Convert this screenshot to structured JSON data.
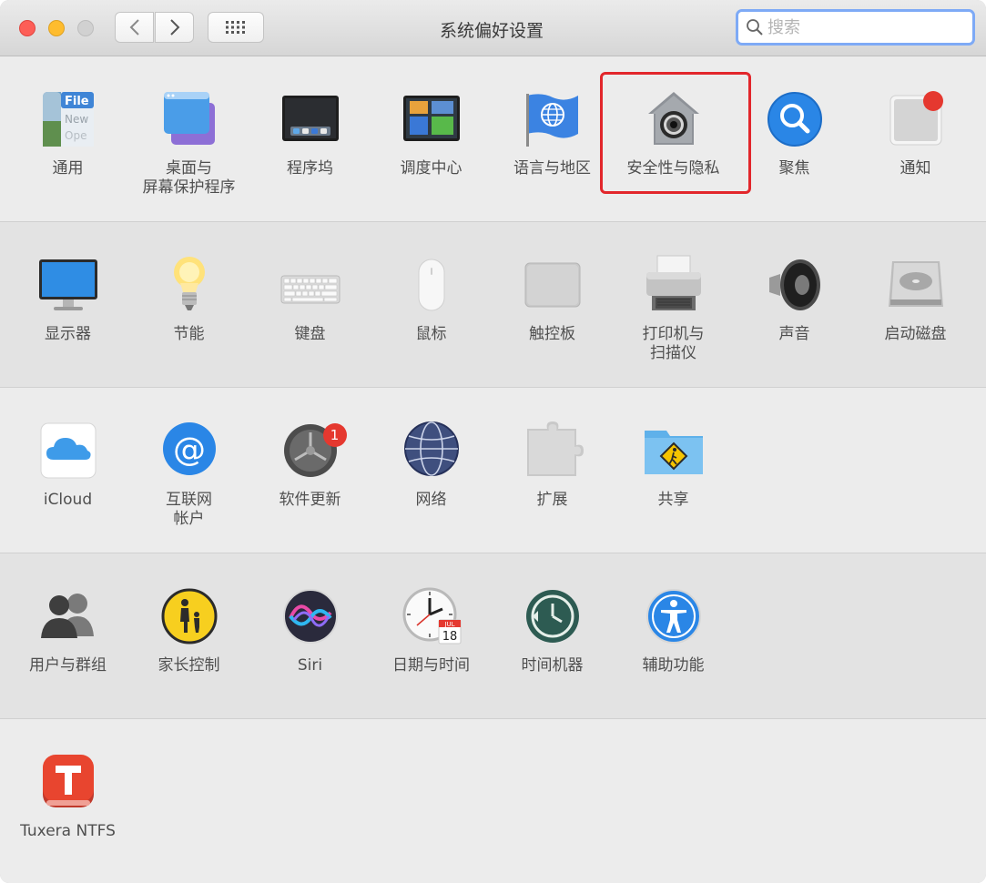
{
  "window": {
    "title": "系统偏好设置",
    "search": {
      "value": "",
      "placeholder": "搜索"
    }
  },
  "colors": {
    "accent_focus": "#7eaaf6",
    "highlight": "#e2262b",
    "badge": "#e5382f"
  },
  "sections": [
    {
      "items": [
        {
          "label": "通用",
          "icon": "general-icon"
        },
        {
          "label": "桌面与\n屏幕保护程序",
          "icon": "desktop-screensaver-icon"
        },
        {
          "label": "程序坞",
          "icon": "dock-icon"
        },
        {
          "label": "调度中心",
          "icon": "mission-control-icon"
        },
        {
          "label": "语言与地区",
          "icon": "language-region-icon"
        },
        {
          "label": "安全性与隐私",
          "icon": "security-privacy-icon",
          "highlighted": true
        },
        {
          "label": "聚焦",
          "icon": "spotlight-icon"
        },
        {
          "label": "通知",
          "icon": "notifications-icon"
        }
      ]
    },
    {
      "items": [
        {
          "label": "显示器",
          "icon": "displays-icon"
        },
        {
          "label": "节能",
          "icon": "energy-saver-icon"
        },
        {
          "label": "键盘",
          "icon": "keyboard-icon"
        },
        {
          "label": "鼠标",
          "icon": "mouse-icon"
        },
        {
          "label": "触控板",
          "icon": "trackpad-icon"
        },
        {
          "label": "打印机与\n扫描仪",
          "icon": "printers-scanners-icon"
        },
        {
          "label": "声音",
          "icon": "sound-icon"
        },
        {
          "label": "启动磁盘",
          "icon": "startup-disk-icon"
        }
      ]
    },
    {
      "items": [
        {
          "label": "iCloud",
          "icon": "icloud-icon"
        },
        {
          "label": "互联网\n帐户",
          "icon": "internet-accounts-icon"
        },
        {
          "label": "软件更新",
          "icon": "software-update-icon",
          "badge": "1"
        },
        {
          "label": "网络",
          "icon": "network-icon"
        },
        {
          "label": "扩展",
          "icon": "extensions-icon"
        },
        {
          "label": "共享",
          "icon": "sharing-icon"
        }
      ]
    },
    {
      "items": [
        {
          "label": "用户与群组",
          "icon": "users-groups-icon"
        },
        {
          "label": "家长控制",
          "icon": "parental-controls-icon"
        },
        {
          "label": "Siri",
          "icon": "siri-icon"
        },
        {
          "label": "日期与时间",
          "icon": "date-time-icon",
          "calendar_month": "JUL",
          "calendar_day": "18"
        },
        {
          "label": "时间机器",
          "icon": "time-machine-icon"
        },
        {
          "label": "辅助功能",
          "icon": "accessibility-icon"
        }
      ]
    },
    {
      "items": [
        {
          "label": "Tuxera NTFS",
          "icon": "tuxera-ntfs-icon"
        }
      ]
    }
  ],
  "general_icon_text": [
    "File",
    "New",
    "Ope"
  ]
}
